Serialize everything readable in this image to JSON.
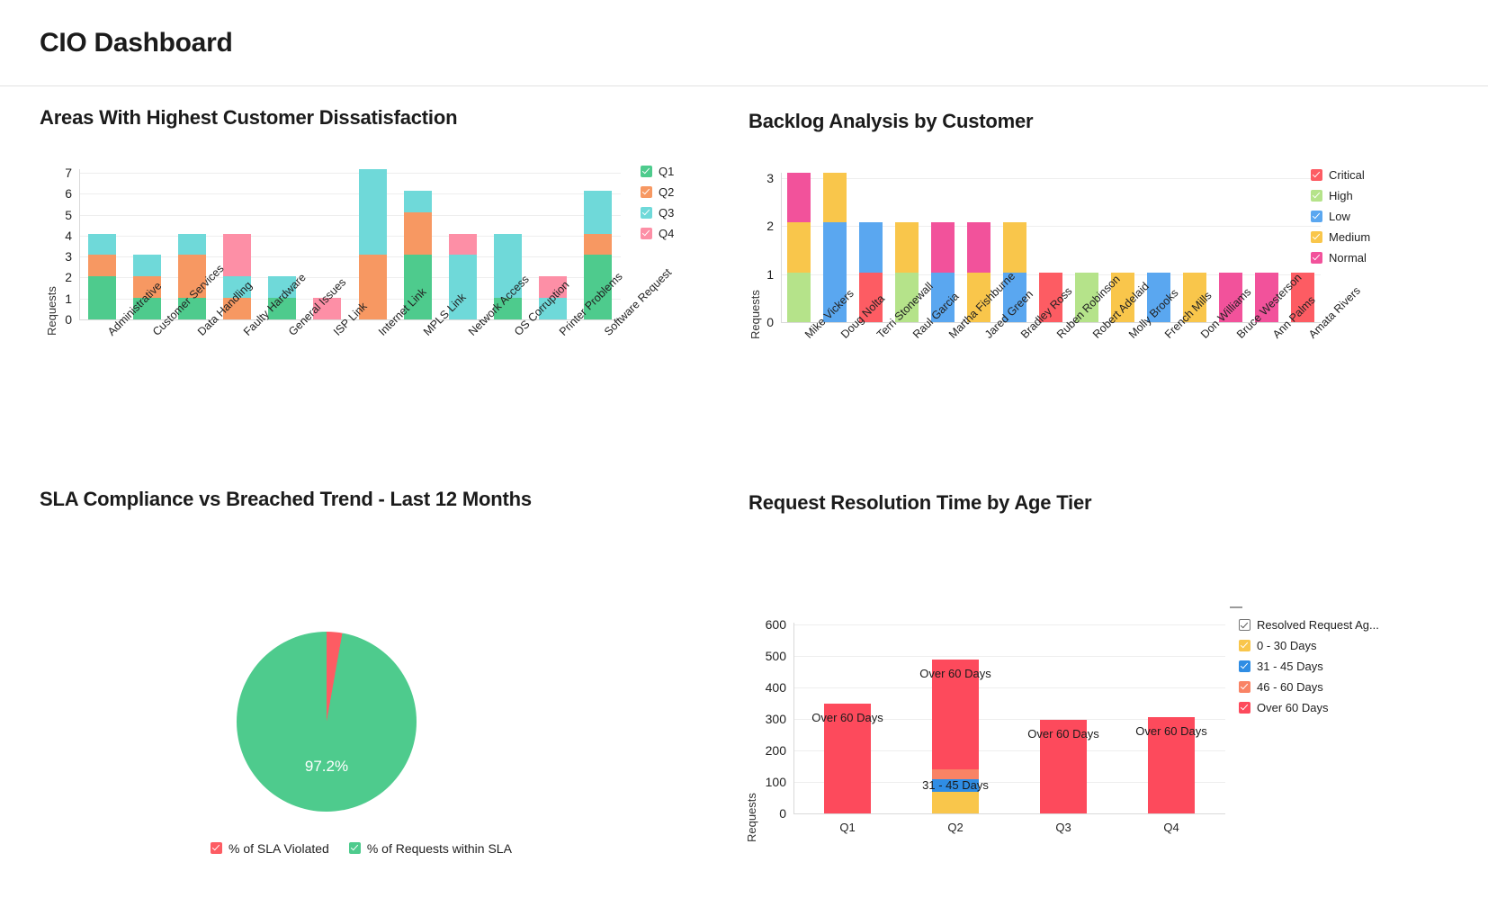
{
  "header": {
    "title": "CIO Dashboard"
  },
  "panels": {
    "dissatisfaction": {
      "title": "Areas With Highest Customer Dissatisfaction"
    },
    "backlog": {
      "title": "Backlog Analysis by Customer"
    },
    "sla": {
      "title": "SLA Compliance vs Breached Trend - Last 12 Months"
    },
    "resolution": {
      "title": "Request Resolution Time by Age Tier"
    }
  },
  "chart_data": [
    {
      "id": "dissatisfaction",
      "type": "bar",
      "stacked": true,
      "title": "Areas With Highest Customer Dissatisfaction",
      "xlabel": "",
      "ylabel": "Requests",
      "ylim": [
        0,
        7
      ],
      "yticks": [
        0,
        1,
        2,
        3,
        4,
        5,
        6,
        7
      ],
      "grid": true,
      "legend_position": "right",
      "categories": [
        "Administrative",
        "Customer Services",
        "Data Handling",
        "Faulty Hardware",
        "General Issues",
        "ISP Link",
        "Internet Link",
        "MPLS Link",
        "Network Access",
        "OS Corruption",
        "Printer Problems",
        "Software Request"
      ],
      "series": [
        {
          "name": "Q1",
          "color": "#4ecb8d",
          "values": [
            2,
            1,
            1,
            0,
            1,
            0,
            0,
            3,
            0,
            1,
            0,
            3
          ]
        },
        {
          "name": "Q2",
          "color": "#f79862",
          "values": [
            1,
            1,
            2,
            1,
            0,
            0,
            3,
            2,
            0,
            0,
            0,
            1
          ]
        },
        {
          "name": "Q3",
          "color": "#6fd9d9",
          "values": [
            1,
            1,
            1,
            1,
            1,
            0,
            4,
            1,
            3,
            3,
            1,
            2
          ]
        },
        {
          "name": "Q4",
          "color": "#fd8fa6",
          "values": [
            0,
            0,
            0,
            2,
            0,
            1,
            0,
            0,
            1,
            0,
            1,
            0
          ]
        }
      ]
    },
    {
      "id": "backlog",
      "type": "bar",
      "stacked": true,
      "title": "Backlog Analysis by Customer",
      "xlabel": "",
      "ylabel": "Requests",
      "ylim": [
        0,
        3
      ],
      "yticks": [
        0,
        1,
        2,
        3
      ],
      "grid": true,
      "legend_position": "right",
      "categories": [
        "Mike Vickers",
        "Doug Nolta",
        "Terri Stonewall",
        "Raul Garcia",
        "Martha Fishburne",
        "Jared Green",
        "Bradley Ross",
        "Ruben Robinson",
        "Robert Adelaid",
        "Molly Brooks",
        "French Mills",
        "Don Williams",
        "Bruce Westerson",
        "Ann Palms",
        "Amata Rivers"
      ],
      "series": [
        {
          "name": "Critical",
          "color": "#fd5c63",
          "values": [
            0,
            0,
            1,
            0,
            0,
            0,
            0,
            1,
            0,
            0,
            0,
            0,
            0,
            0,
            1
          ]
        },
        {
          "name": "High",
          "color": "#b5e38a",
          "values": [
            1,
            0,
            0,
            1,
            0,
            0,
            0,
            0,
            1,
            0,
            0,
            0,
            0,
            0,
            0
          ]
        },
        {
          "name": "Low",
          "color": "#5aa7f0",
          "values": [
            0,
            2,
            1,
            0,
            1,
            0,
            1,
            0,
            0,
            0,
            1,
            0,
            0,
            0,
            0
          ]
        },
        {
          "name": "Medium",
          "color": "#f9c64b",
          "values": [
            1,
            1,
            0,
            1,
            0,
            1,
            1,
            0,
            0,
            1,
            0,
            1,
            0,
            0,
            0
          ]
        },
        {
          "name": "Normal",
          "color": "#f2529b",
          "values": [
            1,
            0,
            0,
            0,
            1,
            1,
            0,
            0,
            0,
            0,
            0,
            0,
            1,
            1,
            0
          ]
        }
      ]
    },
    {
      "id": "sla",
      "type": "pie",
      "title": "SLA Compliance vs Breached Trend - Last 12 Months",
      "legend_position": "bottom",
      "slices": [
        {
          "label": "% of SLA Violated",
          "value": 2.8,
          "color": "#fd5c63",
          "display": ""
        },
        {
          "label": "% of Requests within SLA",
          "value": 97.2,
          "color": "#4ecb8d",
          "display": "97.2%"
        }
      ]
    },
    {
      "id": "resolution",
      "type": "bar",
      "stacked": true,
      "title": "Request Resolution Time by Age Tier",
      "xlabel": "",
      "ylabel": "Requests",
      "ylim": [
        0,
        600
      ],
      "yticks": [
        0,
        100,
        200,
        300,
        400,
        500,
        600
      ],
      "grid": true,
      "legend_position": "right",
      "categories": [
        "Q1",
        "Q2",
        "Q3",
        "Q4"
      ],
      "series": [
        {
          "name": "0 - 30 Days",
          "color": "#f9c64b",
          "values": [
            0,
            70,
            0,
            0
          ]
        },
        {
          "name": "31 - 45 Days",
          "color": "#2f8de4",
          "values": [
            0,
            40,
            0,
            0
          ]
        },
        {
          "name": "46 - 60 Days",
          "color": "#f98365",
          "values": [
            0,
            30,
            0,
            0
          ]
        },
        {
          "name": "Over 60 Days",
          "color": "#fd4a5c",
          "values": [
            350,
            350,
            298,
            305
          ]
        }
      ],
      "bar_labels": [
        {
          "category": "Q1",
          "text": "Over 60 Days"
        },
        {
          "category": "Q2",
          "text": "Over 60 Days"
        },
        {
          "category": "Q2",
          "text": "31 - 45 Days"
        },
        {
          "category": "Q3",
          "text": "Over 60 Days"
        },
        {
          "category": "Q4",
          "text": "Over 60 Days"
        }
      ],
      "legend_header": {
        "label": "Resolved Request Ag...",
        "checked": true
      }
    }
  ]
}
